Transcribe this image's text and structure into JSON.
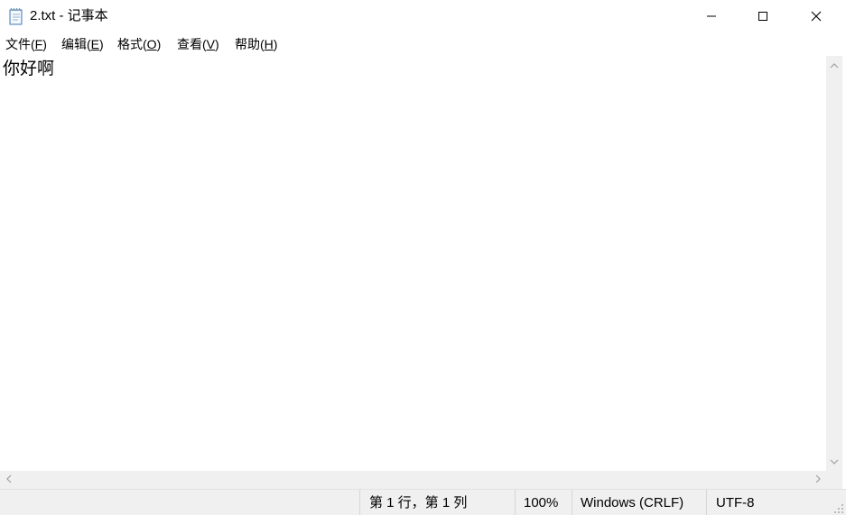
{
  "window": {
    "title": "2.txt - 记事本",
    "icon": "notepad-icon",
    "controls": [
      "minimize-icon",
      "maximize-icon",
      "close-icon"
    ]
  },
  "menu": {
    "file": {
      "label": "文件(",
      "accel": "F",
      "tail": ")"
    },
    "edit": {
      "label": "编辑(",
      "accel": "E",
      "tail": ")"
    },
    "format": {
      "label": "格式(",
      "accel": "O",
      "tail": ")"
    },
    "view": {
      "label": "查看(",
      "accel": "V",
      "tail": ")"
    },
    "help": {
      "label": "帮助(",
      "accel": "H",
      "tail": ")"
    }
  },
  "editor": {
    "content": "你好啊"
  },
  "status": {
    "position": "第 1 行，第 1 列",
    "zoom": "100%",
    "line_ending": "Windows (CRLF)",
    "encoding": "UTF-8"
  },
  "colors": {
    "window_bg": "#ffffff",
    "chrome_bg": "#f0f0f0",
    "icon_stroke": "#000000",
    "scroll_arrow": "#a0a0a0"
  }
}
